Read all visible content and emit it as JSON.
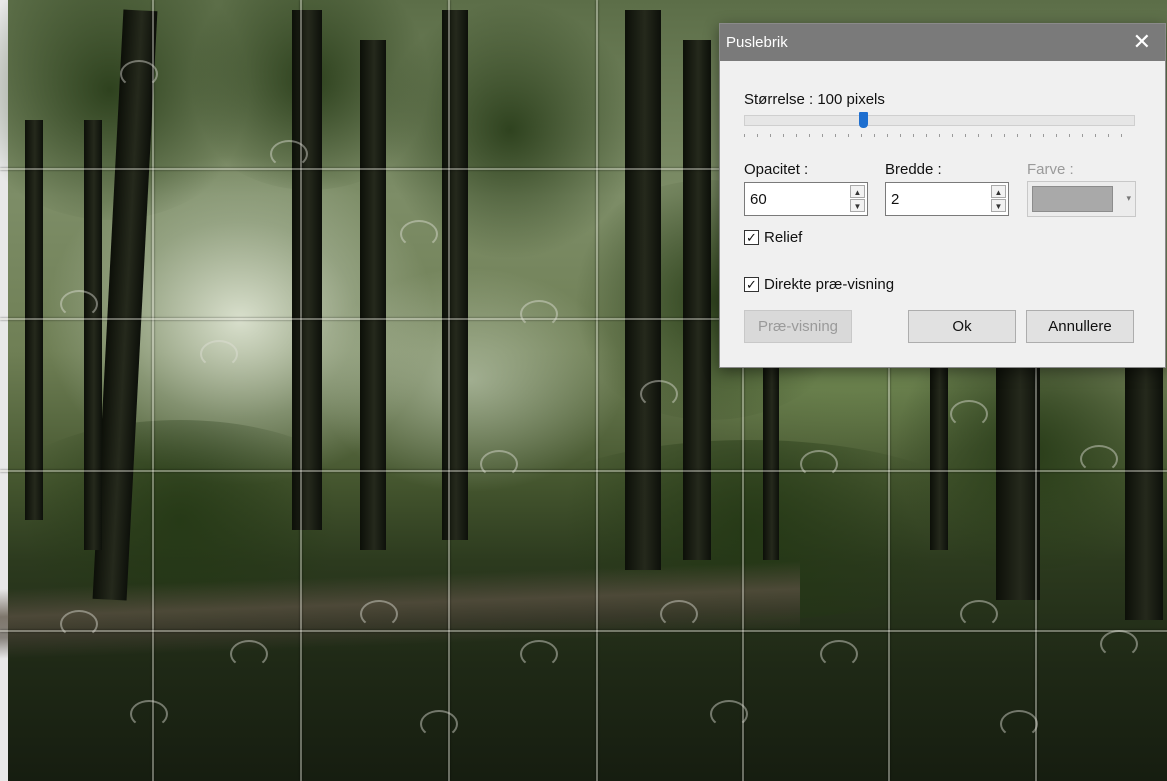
{
  "dialog": {
    "title": "Puslebrik",
    "close_glyph": "✕",
    "size_label": "Størrelse : 100 pixels",
    "size_slider_fraction": 0.3,
    "opacity_label": "Opacitet :",
    "opacity_value": "60",
    "width_label": "Bredde :",
    "width_value": "2",
    "color_label": "Farve :",
    "color_value": "#a9a9a9",
    "relief_label": "Relief",
    "relief_checked": true,
    "live_preview_label": "Direkte præ-visning",
    "live_preview_checked": true,
    "preview_button": "Præ-visning",
    "ok_button": "Ok",
    "cancel_button": "Annullere",
    "spin_up_glyph": "▲",
    "spin_down_glyph": "▼",
    "combo_arrow_glyph": "▾",
    "check_glyph": "✓"
  },
  "background": {
    "description_icon": "forest-photo-puzzle"
  }
}
